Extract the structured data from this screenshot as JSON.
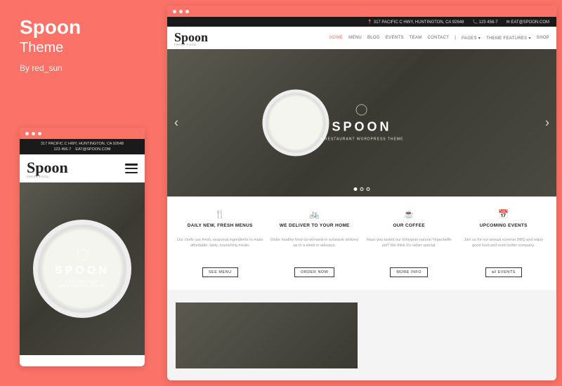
{
  "sidebar": {
    "title": "Spoon",
    "subtitle": "Theme",
    "byline": "By red_sun"
  },
  "topbar": {
    "address": "317 PACIFIC C HWY, HUNTINGTON, CA 92648",
    "phone": "123 456-7",
    "email": "EAT@SPOON.COM"
  },
  "logo": {
    "text": "Spoon",
    "tagline": "FRESH FOOD"
  },
  "nav": [
    "HOME",
    "MENU",
    "BLOG",
    "EVENTS",
    "TEAM",
    "CONTACT",
    "|",
    "PAGES ▾",
    "THEME FEATURES ▾",
    "SHOP"
  ],
  "hero": {
    "title": "SPOON",
    "subtitle": "A RESTAURANT WORDPRESS THEME"
  },
  "features": [
    {
      "icon": "🍴",
      "title": "DAILY NEW, FRESH MENUS",
      "desc": "Our chefs use fresh, seasonal ingredients to make affordable, tasty, nourishing meals.",
      "btn": "SEE MENU"
    },
    {
      "icon": "🚲",
      "title": "WE DELIVER TO YOUR HOME",
      "desc": "Order healthy food on-demand or schedule delivery up to a week in advance.",
      "btn": "ORDER NOW"
    },
    {
      "icon": "☕",
      "title": "OUR COFFEE",
      "desc": "Have you tasted our Ethiopian natural Yirgacheffe yet? We think it's rather special.",
      "btn": "MORE INFO"
    },
    {
      "icon": "📅",
      "title": "UPCOMING EVENTS",
      "desc": "Join us for our annual summer BBQ and enjoy good food and even better company.",
      "btn": "all EVENTS"
    }
  ]
}
